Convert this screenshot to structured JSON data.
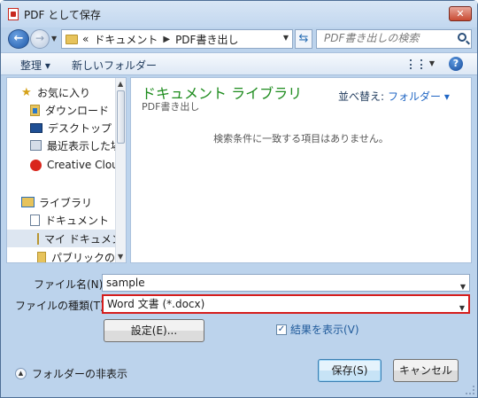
{
  "window": {
    "title": "PDF として保存",
    "close_glyph": "✕"
  },
  "nav": {
    "back_glyph": "←",
    "forward_glyph": "→",
    "breadcrumb_prefix": "«",
    "breadcrumb": [
      "ドキュメント",
      "PDF書き出し"
    ],
    "search_placeholder": "PDF書き出しの検索"
  },
  "toolbar": {
    "organize": "整理 ▾",
    "new_folder": "新しいフォルダー",
    "help": "?"
  },
  "sidebar": {
    "favorites": "お気に入り",
    "items": [
      "ダウンロード",
      "デスクトップ",
      "最近表示した場所",
      "Creative Cloud"
    ],
    "library": "ライブラリ",
    "lib_items": [
      "ドキュメント",
      "マイ ドキュメント",
      "パブリックのドキュメント"
    ]
  },
  "content": {
    "title": "ドキュメント ライブラリ",
    "subtitle": "PDF書き出し",
    "sort_label": "並べ替え:",
    "sort_value": "フォルダー ▾",
    "empty_message": "検索条件に一致する項目はありません。"
  },
  "form": {
    "filename_label": "ファイル名(N):",
    "filename_value": "sample",
    "filetype_label": "ファイルの種類(T):",
    "filetype_value": "Word 文書 (*.docx)",
    "settings_button": "設定(E)...",
    "show_result_label": "結果を表示(V)",
    "show_result_checked": true
  },
  "footer": {
    "hide_folders": "フォルダーの非表示",
    "save": "保存(S)",
    "cancel": "キャンセル"
  },
  "colors": {
    "accent": "#2066c4",
    "library_title": "#1e8c1e",
    "highlight_border": "#d51d1d"
  }
}
